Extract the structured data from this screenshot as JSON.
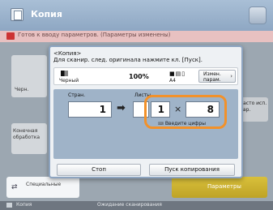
{
  "app": {
    "title": "Копия",
    "status": "Готов к вводу параметров. (Параметры изменены)"
  },
  "background": {
    "left_button_label": "Черн.",
    "finish_button_label": "Конечная обработка",
    "right_button_label": "Часто исп. пар.",
    "special_button_label": "Специальные",
    "params_button_label": "Параметры"
  },
  "dialog": {
    "heading_line1": "<Копия>",
    "heading_line2": "Для сканир. след. оригинала нажмите кл. [Пуск].",
    "color_label": "Черный",
    "zoom": "100%",
    "paper_size": "A4",
    "change_button_label": "Измен. парам.",
    "originals_label": "Стран.",
    "sheets_label": "Листы",
    "originals_value": "1",
    "sheets_value": "",
    "copies_a": "1",
    "multiply_sign": "×",
    "copies_b": "8",
    "enter_hint": "Введите цифры",
    "stop_label": "Стоп",
    "start_label": "Пуск копирования"
  },
  "footer": {
    "job": "Копия",
    "state": "Ожидание сканирования"
  },
  "colors": {
    "highlight": "#f2912a",
    "params": "#d9c03b"
  }
}
